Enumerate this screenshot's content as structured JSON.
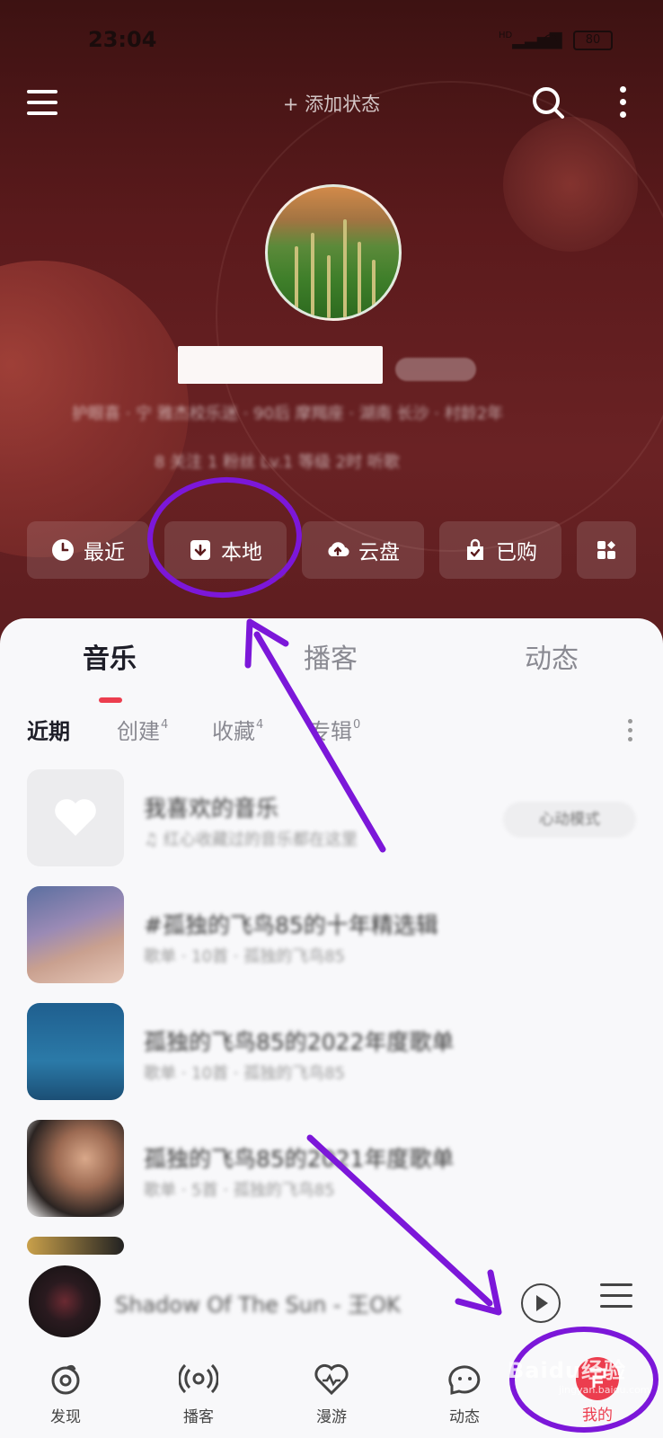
{
  "status_bar": {
    "time": "23:04",
    "signal": "HD",
    "battery": "80"
  },
  "header": {
    "add_status": "+ 添加状态"
  },
  "profile": {
    "tags_line": "护眼喜 · 宁 雅杰校乐迷 · 90后 摩羯座 · 湖南 长沙 · 村龄2年",
    "stats_line": "8 关注    1 粉丝    Lv.1 等级    2时 听歌"
  },
  "quick_actions": [
    {
      "label": "最近",
      "icon": "clock-icon"
    },
    {
      "label": "本地",
      "icon": "download-box-icon"
    },
    {
      "label": "云盘",
      "icon": "cloud-upload-icon"
    },
    {
      "label": "已购",
      "icon": "shopping-bag-icon"
    },
    {
      "label": "",
      "icon": "apps-grid-icon"
    }
  ],
  "tabs": [
    {
      "label": "音乐",
      "active": true
    },
    {
      "label": "播客",
      "active": false
    },
    {
      "label": "动态",
      "active": false
    }
  ],
  "subtabs": [
    {
      "label": "近期",
      "count": "",
      "active": true
    },
    {
      "label": "创建",
      "count": "4",
      "active": false
    },
    {
      "label": "收藏",
      "count": "4",
      "active": false
    },
    {
      "label": "专辑",
      "count": "0",
      "active": false
    }
  ],
  "playlists": [
    {
      "title": "我喜欢的音乐",
      "subtitle": "♫ 红心收藏过的音乐都在这里",
      "badge": "心动模式"
    },
    {
      "title": "#孤独的飞鸟85的十年精选辑",
      "subtitle": "歌单 · 10首 · 孤独的飞鸟85"
    },
    {
      "title": "孤独的飞鸟85的2022年度歌单",
      "subtitle": "歌单 · 10首 · 孤独的飞鸟85"
    },
    {
      "title": "孤独的飞鸟85的2021年度歌单",
      "subtitle": "歌单 · 5首 · 孤独的飞鸟85"
    }
  ],
  "mini_player": {
    "song": "Shadow Of The Sun - 王OK"
  },
  "bottom_nav": [
    {
      "label": "发现",
      "icon": "discover-icon"
    },
    {
      "label": "播客",
      "icon": "podcast-icon"
    },
    {
      "label": "漫游",
      "icon": "heart-wave-icon"
    },
    {
      "label": "动态",
      "icon": "chat-bubble-icon"
    },
    {
      "label": "我的",
      "icon": "music-note-icon",
      "active": true
    }
  ],
  "watermark": {
    "main": "Baidu经验",
    "sub": "jingyan.baidu.com"
  },
  "colors": {
    "accent": "#ec3d4e",
    "annotation": "#7c17d9",
    "header_bg": "#5b1a1c"
  }
}
